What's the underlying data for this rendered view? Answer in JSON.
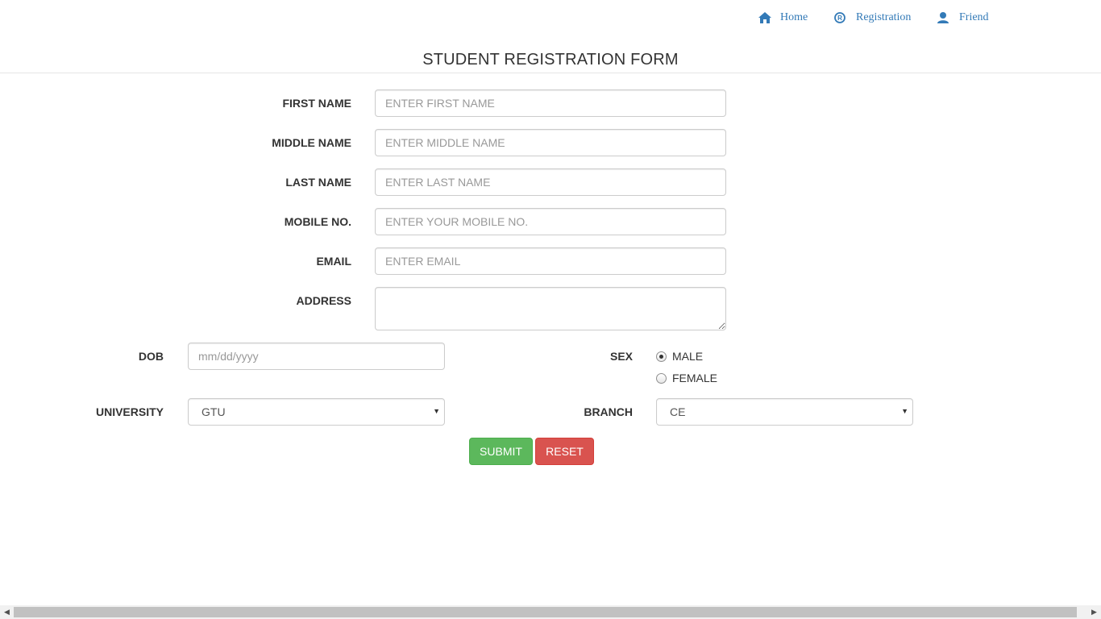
{
  "nav": {
    "items": [
      {
        "label": "Home",
        "icon": "home-icon"
      },
      {
        "label": "Registration",
        "icon": "registered-icon"
      },
      {
        "label": "Friend",
        "icon": "user-icon"
      }
    ]
  },
  "page": {
    "title": "STUDENT REGISTRATION FORM"
  },
  "form": {
    "first_name": {
      "label": "FIRST NAME",
      "placeholder": "ENTER FIRST NAME"
    },
    "middle_name": {
      "label": "MIDDLE NAME",
      "placeholder": "ENTER MIDDLE NAME"
    },
    "last_name": {
      "label": "LAST NAME",
      "placeholder": "ENTER LAST NAME"
    },
    "mobile": {
      "label": "MOBILE NO.",
      "placeholder": "ENTER YOUR MOBILE NO."
    },
    "email": {
      "label": "EMAIL",
      "placeholder": "ENTER EMAIL"
    },
    "address": {
      "label": "ADDRESS",
      "value": ""
    },
    "dob": {
      "label": "DOB",
      "placeholder": "mm/dd/yyyy"
    },
    "sex": {
      "label": "SEX",
      "options": [
        "MALE",
        "FEMALE"
      ],
      "selected": "MALE"
    },
    "university": {
      "label": "UNIVERSITY",
      "selected": "GTU"
    },
    "branch": {
      "label": "BRANCH",
      "selected": "CE"
    }
  },
  "buttons": {
    "submit": "SUBMIT",
    "reset": "RESET"
  },
  "colors": {
    "link": "#337ab7",
    "success": "#5cb85c",
    "danger": "#d9534f"
  }
}
